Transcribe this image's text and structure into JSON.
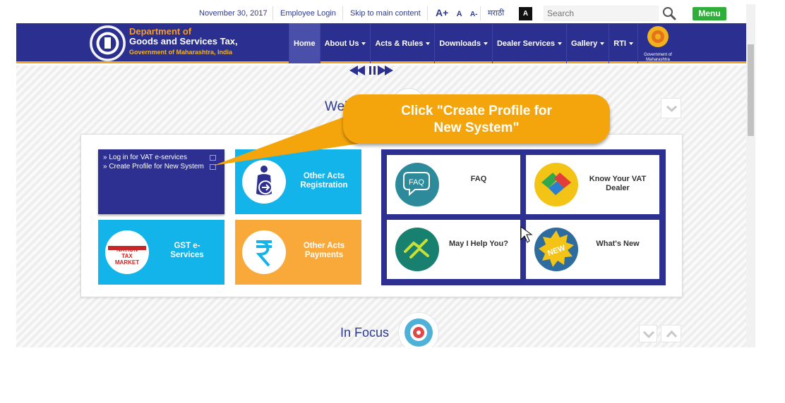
{
  "topbar": {
    "date": "November 30, 2017",
    "employee_login": "Employee Login",
    "skip_link": "Skip to main content",
    "font_increase": "A+",
    "font_normal": "A",
    "font_decrease": "A-",
    "language": "मराठी",
    "contrast": "A",
    "search_placeholder": "Search",
    "menu": "Menu"
  },
  "header": {
    "dept_line1": "Department of",
    "dept_line2": "Goods and Services Tax,",
    "dept_line3": "Government of Maharashtra, India",
    "gov_logo_label1": "Government of",
    "gov_logo_label2": "Maharashtra"
  },
  "nav": {
    "items": [
      {
        "label": "Home"
      },
      {
        "label": "About Us"
      },
      {
        "label": "Acts & Rules"
      },
      {
        "label": "Downloads"
      },
      {
        "label": "Dealer Services"
      },
      {
        "label": "Gallery"
      },
      {
        "label": "RTI"
      }
    ]
  },
  "content": {
    "welcome": "Welc",
    "vat_link1": "» Log in for VAT e-services",
    "vat_link2": "» Create Profile for New System",
    "other_acts_registration": "Other Acts Registration",
    "gst_eservices": "GST e-Services",
    "gst_logo_text1": "NATION",
    "gst_logo_text2": "TAX",
    "gst_logo_text3": "MARKET",
    "other_acts_payments": "Other Acts Payments",
    "faq": "FAQ",
    "faq_bubble": "FAQ",
    "know_dealer": "Know Your VAT Dealer",
    "help": "May I Help You?",
    "whats_new": "What's New",
    "new_badge": "NEW",
    "in_focus": "In Focus"
  },
  "callout": {
    "line1": "Click \"Create Profile for",
    "line2": "New System\""
  },
  "colors": {
    "brand_navy": "#2b2f8f",
    "accent_orange": "#f5a50c",
    "tile_cyan": "#12b4ea",
    "tile_orange": "#f8a93a",
    "menu_green": "#2fae3a"
  }
}
